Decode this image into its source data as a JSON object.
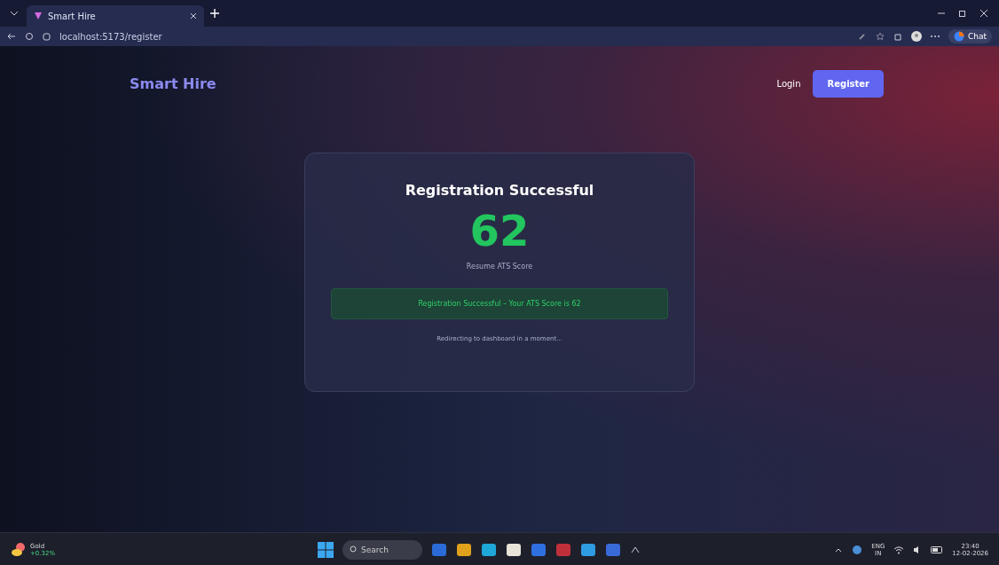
{
  "browser": {
    "tab": {
      "title": "Smart Hire",
      "selected": true
    },
    "address": "localhost:5173/register",
    "chat_label": "Chat"
  },
  "nav": {
    "brand": "Smart Hire",
    "links": [
      {
        "label": "Login",
        "kind": "link"
      },
      {
        "label": "Register",
        "kind": "button"
      }
    ]
  },
  "card": {
    "title": "Registration Successful",
    "score": "62",
    "score_label": "Resume ATS Score",
    "alert": "Registration Successful – Your ATS Score is 62",
    "note": "Redirecting to dashboard in a moment..."
  },
  "taskbar": {
    "widget": {
      "name": "Gold",
      "change": "+0.32%"
    },
    "search_placeholder": "Search",
    "language": "ENG",
    "region": "IN",
    "time": "23:40",
    "date": "12-02-2026"
  }
}
